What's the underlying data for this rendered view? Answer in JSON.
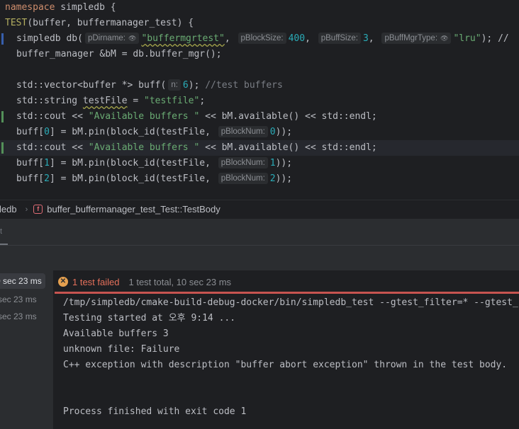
{
  "editor": {
    "lines": {
      "l1": {
        "kw": "namespace",
        "name": " simpledb {"
      },
      "l2": {
        "macro": "TEST",
        "rest": "(buffer, buffermanager_test) {"
      },
      "l3": {
        "type": "simpledb",
        "var": " db(",
        "hint1": "pDirname:",
        "arg1": "\"buffermgrtest\"",
        "comma1": ", ",
        "hint2": "pBlockSize:",
        "arg2": "400",
        "comma2": ", ",
        "hint3": "pBuffSize:",
        "arg3": "3",
        "comma3": ", ",
        "hint4": "pBuffMgrType:",
        "arg4": "\"lru\"",
        "tail": "); //"
      },
      "l4": {
        "text": "buffer_manager &bM = db.buffer_mgr();"
      },
      "l6": {
        "pre": "std::vector<buffer *> buff(",
        "hint": "n:",
        "num": "6",
        "post": ");",
        "cmt": " //test buffers"
      },
      "l7": {
        "pre": "std::string ",
        "var": "testFile",
        "eq": " = ",
        "str": "\"testfile\"",
        "post": ";"
      },
      "l8": {
        "pre": "std::cout << ",
        "str": "\"Available buffers \"",
        "post": " << bM.available() << std::endl;"
      },
      "l9": {
        "pre": "buff[",
        "idx": "0",
        "mid": "] = bM.pin(block_id(testFile, ",
        "hint": "pBlockNum:",
        "num": "0",
        "post": "));"
      },
      "l10": {
        "pre": "std::cout << ",
        "str": "\"Available buffers \"",
        "post": " << bM.available() << std::endl;"
      },
      "l11": {
        "pre": "buff[",
        "idx": "1",
        "mid": "] = bM.pin(block_id(testFile, ",
        "hint": "pBlockNum:",
        "num": "1",
        "post": "));"
      },
      "l12": {
        "pre": "buff[",
        "idx": "2",
        "mid": "] = bM.pin(block_id(testFile, ",
        "hint": "pBlockNum:",
        "num": "2",
        "post": "));"
      }
    }
  },
  "breadcrumb": {
    "first": "ledb",
    "func_badge": "f",
    "func": "buffer_buffermanager_test_Test::TestBody"
  },
  "tool_strip": {
    "label": "t"
  },
  "tree": {
    "rows": [
      {
        "label": "sec 23 ms",
        "partial": "0"
      },
      {
        "label": "sec 23 ms",
        "partial": ""
      },
      {
        "label": "sec 23 ms",
        "partial": ""
      }
    ]
  },
  "console": {
    "status_icon": "✕",
    "failed_text": "1 test failed",
    "total_text": "1 test total, 10 sec 23 ms",
    "output": [
      "/tmp/simpledb/cmake-build-debug-docker/bin/simpledb_test --gtest_filter=* --gtest_c",
      "Testing started at 오후 9:14 ...",
      "Available buffers 3",
      "unknown file: Failure",
      "C++ exception with description \"buffer abort exception\" thrown in the test body.",
      "",
      "",
      "Process finished with exit code 1"
    ]
  },
  "colors": {
    "keyword": "#cf8e6d",
    "string": "#6aab73",
    "number": "#2aacb8",
    "comment": "#7a7e85",
    "macro": "#b3ae60",
    "error": "#c75450",
    "warning_icon": "#e5a04f"
  }
}
